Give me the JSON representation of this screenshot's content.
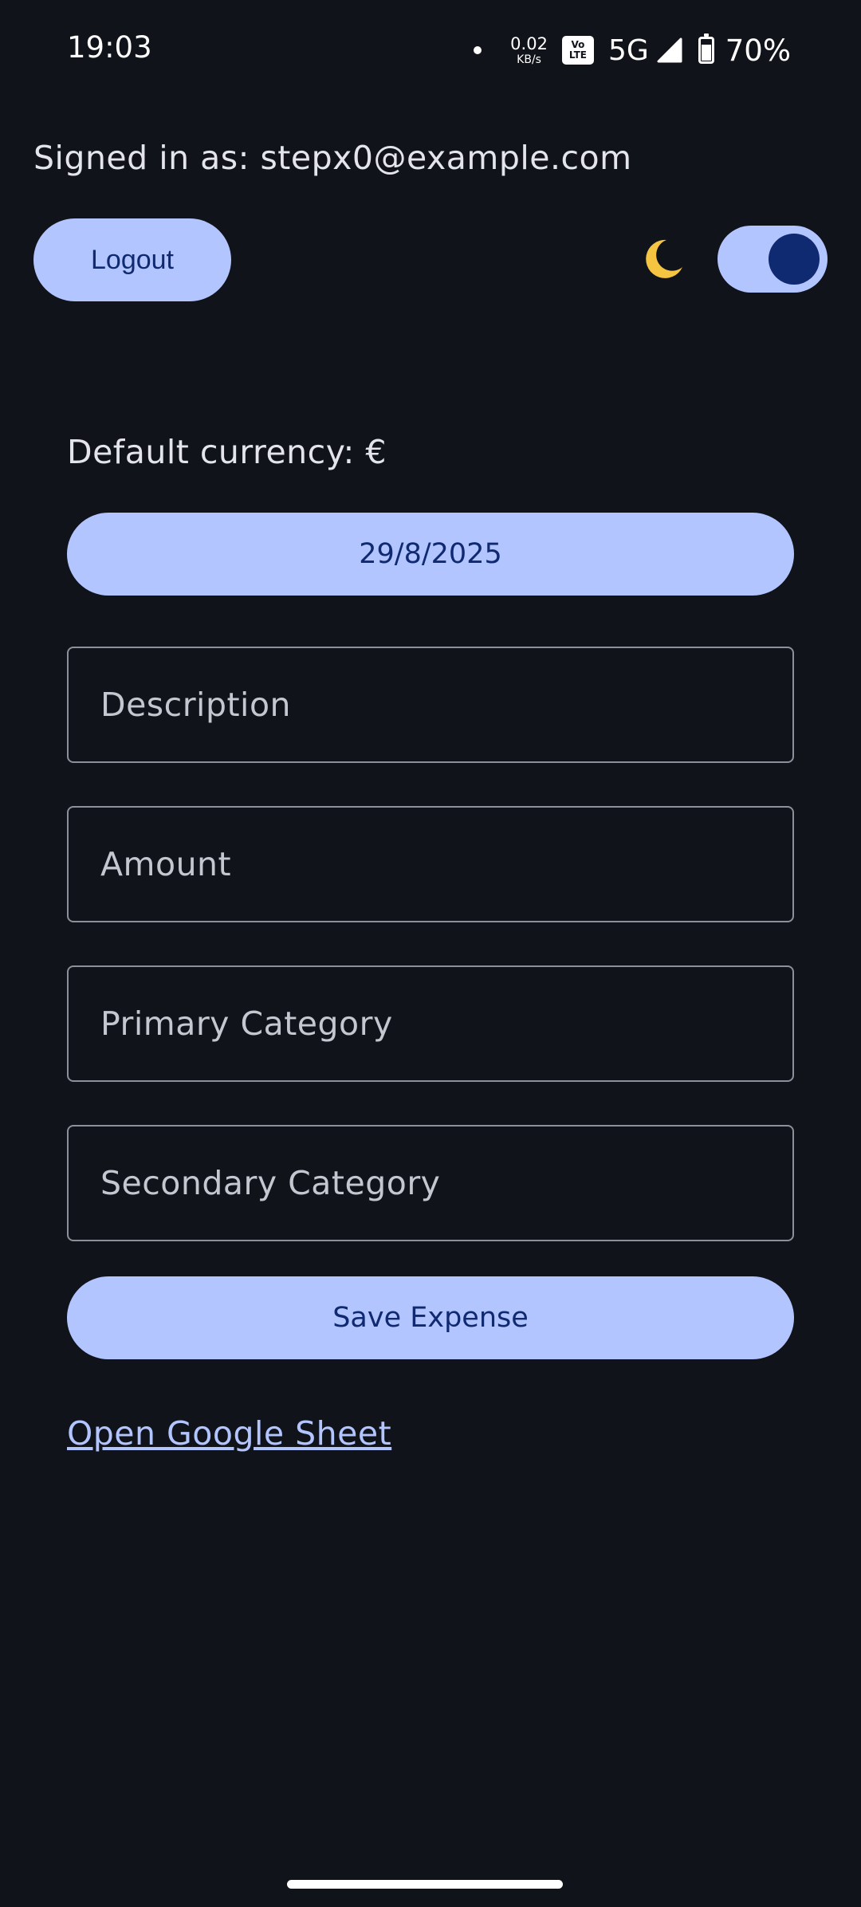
{
  "status_bar": {
    "time": "19:03",
    "net_speed_value": "0.02",
    "net_speed_unit": "KB/s",
    "volte_top": "Vo",
    "volte_bottom": "LTE",
    "network_type": "5G",
    "battery_percent": "70%"
  },
  "header": {
    "signed_in_text": "Signed in as: stepx0@example.com",
    "logout_label": "Logout",
    "theme_icon": "moon-icon",
    "dark_mode_on": true
  },
  "form": {
    "currency_text": "Default currency: €",
    "date_label": "29/8/2025",
    "description_placeholder": "Description",
    "amount_placeholder": "Amount",
    "primary_category_placeholder": "Primary Category",
    "secondary_category_placeholder": "Secondary Category",
    "save_label": "Save Expense",
    "sheet_link_label": "Open Google Sheet"
  },
  "colors": {
    "background": "#11131b",
    "accent": "#b3c5ff",
    "on_accent": "#0f2a70",
    "outline": "#8d909a"
  }
}
